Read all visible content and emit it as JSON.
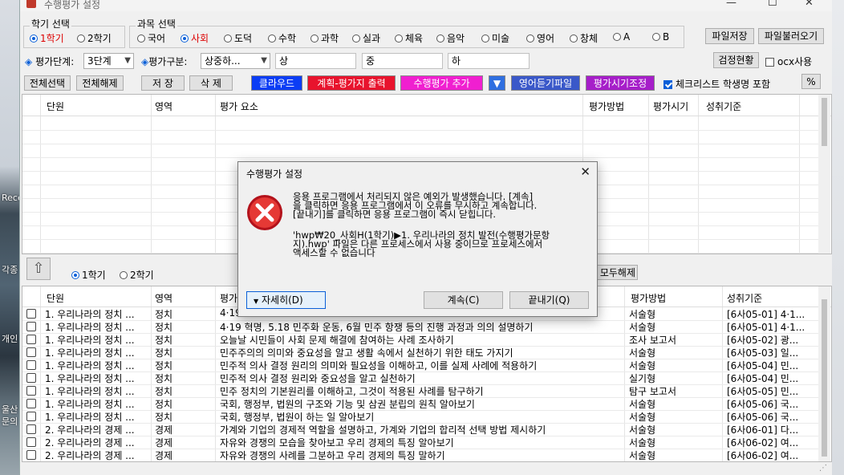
{
  "desktop": {
    "label1": "Rece",
    "label2": "각종",
    "label3": "개인",
    "label4": "울산",
    "label5": "문의"
  },
  "window": {
    "title": "수행평가 설정"
  },
  "semester": {
    "title": "학기 선택",
    "options": [
      "1학기",
      "2학기"
    ],
    "selected": "1학기"
  },
  "subject": {
    "title": "과목 선택",
    "options": [
      "국어",
      "사회",
      "도덕",
      "수학",
      "과학",
      "실과",
      "체육",
      "음악",
      "미술",
      "영어",
      "창체",
      "A",
      "B"
    ],
    "selected": "사회"
  },
  "toprightbtns": {
    "save_file": "파일저장",
    "load_file": "파일불러오기",
    "check_status": "검정현황",
    "ocx_label": "ocx사용"
  },
  "filters": {
    "level_label": "◈ 평가단계:",
    "level_value": "3단계",
    "type_label": "◈평가구분:",
    "type_value": "상중하...",
    "level_high": "상",
    "level_mid": "중",
    "level_low": "하"
  },
  "toolbar": {
    "select_all": "전체선택",
    "clear_all": "전체해제",
    "save": "저 장",
    "delete": "삭 제",
    "cloud": "클라우드",
    "plan_print": "계획-평가지 출력",
    "add_eval": "수행평가 추가",
    "dropdown_arrow": "▼",
    "english_listen": "영어듣기파일",
    "time_adjust": "평가시기조정",
    "checklist_label": "체크리스트 학생명 포함",
    "percent": "%"
  },
  "colors": {
    "cloud": "#0b3df5",
    "plan_print": "#e8132d",
    "add_eval": "#f01fd0",
    "dropdown": "#2f6fe0",
    "english_listen": "#3a58c9",
    "time_adjust": "#a61ec9"
  },
  "upper_grid": {
    "headers": [
      "단원",
      "영역",
      "평가 요소",
      "평가방법",
      "평가시기",
      "성취기준"
    ]
  },
  "lower_panel": {
    "semester_options": [
      "1학기",
      "2학기"
    ],
    "selected": "1학기",
    "clear_all_partial": "모두해제"
  },
  "lower_grid": {
    "headers": [
      "단원",
      "영역",
      "평가",
      "평가방법",
      "성취기준"
    ],
    "rows": [
      {
        "unit": "1. 우리나라의 정치 ...",
        "area": "정치",
        "item": "4·19",
        "method": "서술형",
        "std": "[6사05-01] 4·1..."
      },
      {
        "unit": "1. 우리나라의 정치 ...",
        "area": "정치",
        "item": "4·19 혁명, 5.18 민주화 운동, 6월 민주 항쟁 등의 진행 과정과 의의 설명하기",
        "method": "서술형",
        "std": "[6사05-01] 4·1..."
      },
      {
        "unit": "1. 우리나라의 정치 ...",
        "area": "정치",
        "item": "오늘날 시민들이 사회 문제 해결에 참여하는 사례 조사하기",
        "method": "조사 보고서",
        "std": "[6사05-02] 광..."
      },
      {
        "unit": "1. 우리나라의 정치 ...",
        "area": "정치",
        "item": "민주주의의 의미와 중요성을 알고 생활 속에서 실천하기 위한 태도 가지기",
        "method": "서술형",
        "std": "[6사05-03] 일..."
      },
      {
        "unit": "1. 우리나라의 정치 ...",
        "area": "정치",
        "item": "민주적 의사 결정 원리의 의미와 필요성을 이해하고, 이를 실제 사례에 적용하기",
        "method": "서술형",
        "std": "[6사05-04] 민..."
      },
      {
        "unit": "1. 우리나라의 정치 ...",
        "area": "정치",
        "item": "민주적 의사 결정 원리와 중요성을 알고 실천하기",
        "method": "실기형",
        "std": "[6사05-04] 민..."
      },
      {
        "unit": "1. 우리나라의 정치 ...",
        "area": "정치",
        "item": "민주 정치의 기본원리를 이해하고, 그것이 적용된 사례를 탐구하기",
        "method": "탐구 보고서",
        "std": "[6사05-05] 민..."
      },
      {
        "unit": "1. 우리나라의 정치 ...",
        "area": "정치",
        "item": "국회, 행정부, 법원의 구조와 기능 및 삼권 분립의 원칙 알아보기",
        "method": "서술형",
        "std": "[6사05-06] 국..."
      },
      {
        "unit": "1. 우리나라의 정치 ...",
        "area": "정치",
        "item": "국회, 행정부, 법원이 하는 일 알아보기",
        "method": "서술형",
        "std": "[6사05-06] 국..."
      },
      {
        "unit": "2. 우리나라의 경제 ...",
        "area": "경제",
        "item": "가계와 기업의 경제적 역할을 설명하고, 가계와 기업의 합리적 선택 방법 제시하기",
        "method": "서술형",
        "std": "[6사06-01] 다..."
      },
      {
        "unit": "2. 우리나라의 경제 ...",
        "area": "경제",
        "item": "자유와 경쟁의 모습을 찾아보고 우리 경제의 특징 알아보기",
        "method": "서술형",
        "std": "[6사06-02] 여..."
      },
      {
        "unit": "2. 우리나라의 경제 ...",
        "area": "경제",
        "item": "자유와 경쟁의 사례를 그분하고 우리 경제의 특징 말하기",
        "method": "서술형",
        "std": "[6사06-02] 여..."
      }
    ]
  },
  "dialog": {
    "title": "수행평가 설정",
    "message1": "응용 프로그램에서 처리되지 않은 예외가 발생했습니다. [계속]\n을 클릭하면 응용 프로그램에서 이 오류를 무시하고 계속합니다.\n[끝내기]를 클릭하면 응용 프로그램이 즉시 닫힙니다.",
    "message2": "'hwp₩20_사회H(1학기)▶1. 우리나라의 정치 발전(수행평가문항\n지).hwp' 파일은 다른 프로세스에서 사용 중이므로 프로세스에서\n액세스할 수 없습니다",
    "details": "자세히(D)",
    "continue": "계속(C)",
    "quit": "끝내기(Q)"
  }
}
